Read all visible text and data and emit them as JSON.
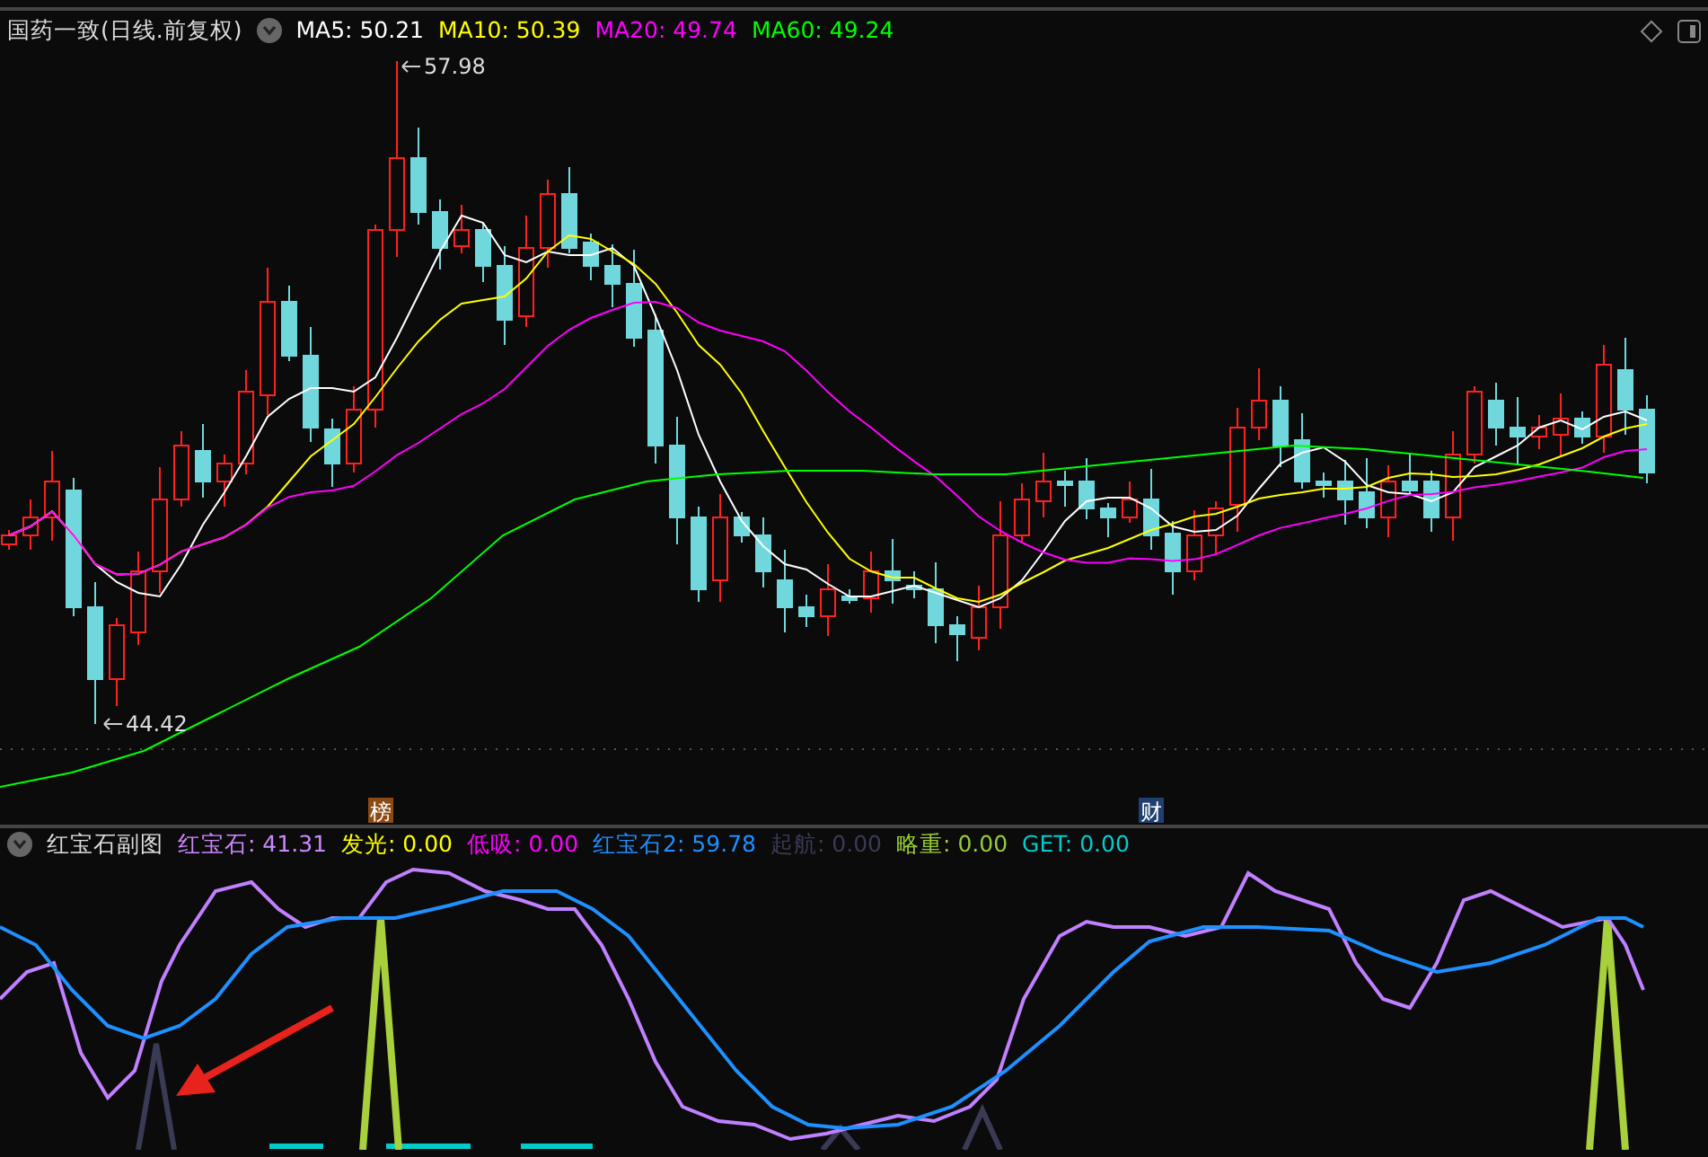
{
  "title": {
    "name": "国药一致(日线.前复权)",
    "indicators": [
      {
        "label": "MA5: 50.21",
        "color": "#ffffff"
      },
      {
        "label": "MA10: 50.39",
        "color": "#ffff00"
      },
      {
        "label": "MA20: 49.74",
        "color": "#ff00ff"
      },
      {
        "label": "MA60: 49.24",
        "color": "#00ff00"
      }
    ]
  },
  "main_chart": {
    "high_label": "57.98",
    "low_label": "44.42",
    "markers": [
      {
        "text": "榜",
        "color": "#8b4a12"
      },
      {
        "text": "财",
        "color": "#1f3f6e"
      }
    ]
  },
  "sub_chart": {
    "name": "红宝石副图",
    "indicators": [
      {
        "label": "红宝石: 41.31",
        "color": "#cc88ff"
      },
      {
        "label": "发光: 0.00",
        "color": "#ffff00"
      },
      {
        "label": "低吸: 0.00",
        "color": "#ff00ff"
      },
      {
        "label": "红宝石2: 59.78",
        "color": "#1e90ff"
      },
      {
        "label": "起航: 0.00",
        "color": "#3a3a55"
      },
      {
        "label": "略重: 0.00",
        "color": "#99cc33"
      },
      {
        "label": "GET: 0.00",
        "color": "#00cccc"
      }
    ]
  }
}
